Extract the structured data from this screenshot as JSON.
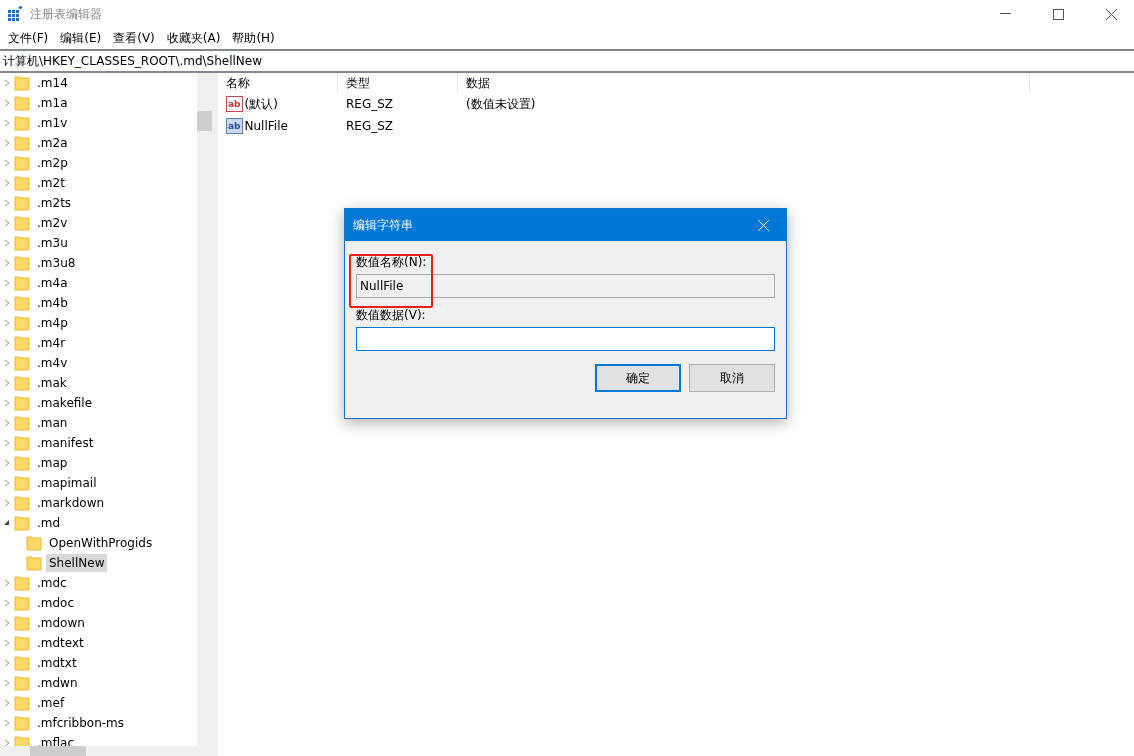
{
  "window": {
    "title": "注册表编辑器"
  },
  "menu": [
    "文件(F)",
    "编辑(E)",
    "查看(V)",
    "收藏夹(A)",
    "帮助(H)"
  ],
  "address": "计算机\\HKEY_CLASSES_ROOT\\.md\\ShellNew",
  "tree": [
    {
      "label": ".m14",
      "expanded": false,
      "selected": false
    },
    {
      "label": ".m1a",
      "expanded": false,
      "selected": false
    },
    {
      "label": ".m1v",
      "expanded": false,
      "selected": false
    },
    {
      "label": ".m2a",
      "expanded": false,
      "selected": false
    },
    {
      "label": ".m2p",
      "expanded": false,
      "selected": false
    },
    {
      "label": ".m2t",
      "expanded": false,
      "selected": false
    },
    {
      "label": ".m2ts",
      "expanded": false,
      "selected": false
    },
    {
      "label": ".m2v",
      "expanded": false,
      "selected": false
    },
    {
      "label": ".m3u",
      "expanded": false,
      "selected": false
    },
    {
      "label": ".m3u8",
      "expanded": false,
      "selected": false
    },
    {
      "label": ".m4a",
      "expanded": false,
      "selected": false
    },
    {
      "label": ".m4b",
      "expanded": false,
      "selected": false
    },
    {
      "label": ".m4p",
      "expanded": false,
      "selected": false
    },
    {
      "label": ".m4r",
      "expanded": false,
      "selected": false
    },
    {
      "label": ".m4v",
      "expanded": false,
      "selected": false
    },
    {
      "label": ".mak",
      "expanded": false,
      "selected": false
    },
    {
      "label": ".makefile",
      "expanded": false,
      "selected": false
    },
    {
      "label": ".man",
      "expanded": false,
      "selected": false
    },
    {
      "label": ".manifest",
      "expanded": false,
      "selected": false
    },
    {
      "label": ".map",
      "expanded": false,
      "selected": false
    },
    {
      "label": ".mapimail",
      "expanded": false,
      "selected": false
    },
    {
      "label": ".markdown",
      "expanded": false,
      "selected": false
    },
    {
      "label": ".md",
      "expanded": true,
      "selected": false,
      "children": [
        {
          "label": "OpenWithProgids",
          "selected": false
        },
        {
          "label": "ShellNew",
          "selected": true
        }
      ]
    },
    {
      "label": ".mdc",
      "expanded": false,
      "selected": false
    },
    {
      "label": ".mdoc",
      "expanded": false,
      "selected": false
    },
    {
      "label": ".mdown",
      "expanded": false,
      "selected": false
    },
    {
      "label": ".mdtext",
      "expanded": false,
      "selected": false
    },
    {
      "label": ".mdtxt",
      "expanded": false,
      "selected": false
    },
    {
      "label": ".mdwn",
      "expanded": false,
      "selected": false
    },
    {
      "label": ".mef",
      "expanded": false,
      "selected": false
    },
    {
      "label": ".mfcribbon-ms",
      "expanded": false,
      "selected": false
    },
    {
      "label": ".mflac",
      "expanded": false,
      "selected": false
    }
  ],
  "values": {
    "columns": [
      "名称",
      "类型",
      "数据"
    ],
    "rows": [
      {
        "icon": "ab",
        "kind": "default",
        "cells": [
          "(默认)",
          "REG_SZ",
          "(数值未设置)"
        ]
      },
      {
        "icon": "ab",
        "kind": "value",
        "cells": [
          "NullFile",
          "REG_SZ"
        ]
      }
    ]
  },
  "dialog": {
    "title": "编辑字符串",
    "name_label": "数值名称(N):",
    "name_value": "NullFile",
    "data_label": "数值数据(V):",
    "buttons": [
      {
        "label": "确定",
        "default": true
      },
      {
        "label": "取消",
        "default": false
      }
    ]
  }
}
